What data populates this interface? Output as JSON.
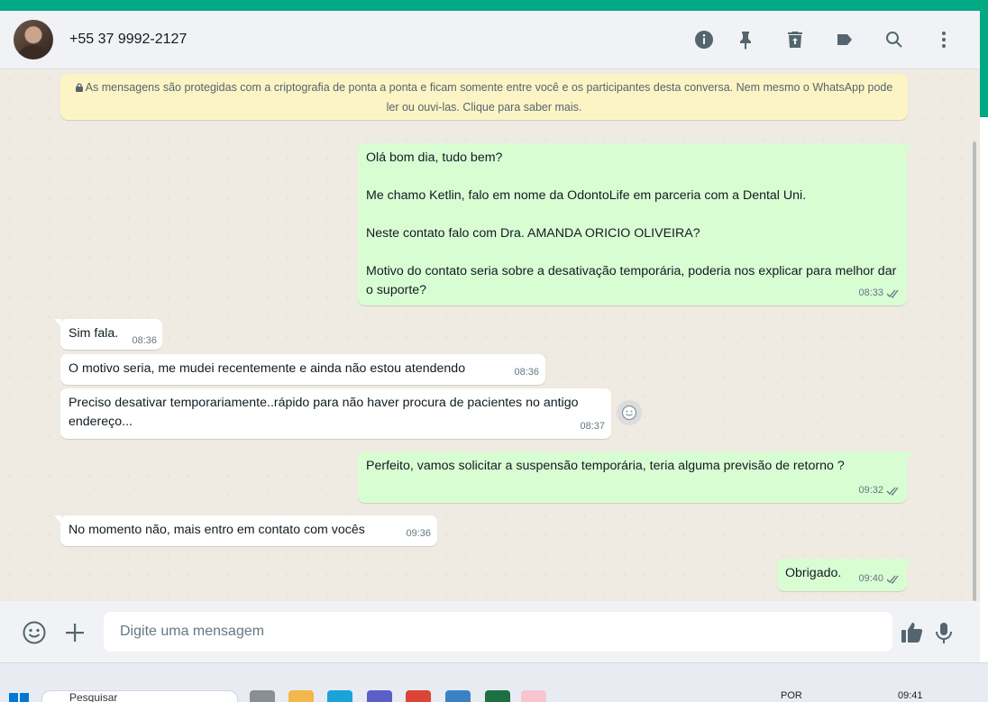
{
  "header": {
    "contact_name": "+55 37 9992-2127",
    "icons": [
      "info-icon",
      "pin-icon",
      "delete-icon",
      "label-icon",
      "search-icon",
      "menu-icon"
    ]
  },
  "encryption_notice": "As mensagens são protegidas com a criptografia de ponta a ponta e ficam somente entre você e os participantes desta conversa. Nem mesmo o WhatsApp pode ler ou ouvi-las. Clique para saber mais.",
  "messages": [
    {
      "dir": "out",
      "text": "Olá bom dia, tudo bem?\n\nMe chamo Ketlin, falo em nome da OdontoLife em parceria com a Dental Uni.\n\nNeste contato falo com Dra. AMANDA ORICIO OLIVEIRA?\n\nMotivo do contato seria sobre a desativação temporária, poderia nos explicar para melhor dar o suporte?",
      "time": "08:33",
      "status": "read"
    },
    {
      "dir": "in",
      "text": "Sim fala.",
      "time": "08:36"
    },
    {
      "dir": "in",
      "text": "O motivo seria, me mudei recentemente e ainda não estou atendendo",
      "time": "08:36"
    },
    {
      "dir": "in",
      "text": "Preciso desativar temporariamente..rápido para não haver procura de pacientes no antigo endereço...",
      "time": "08:37"
    },
    {
      "dir": "out",
      "text": "Perfeito, vamos solicitar a suspensão temporária, teria alguma previsão de retorno ?",
      "time": "09:32",
      "status": "read"
    },
    {
      "dir": "in",
      "text": "No momento não, mais entro em contato com vocês",
      "time": "09:36"
    },
    {
      "dir": "out",
      "text": "Obrigado.",
      "time": "09:40",
      "status": "read"
    }
  ],
  "composer": {
    "placeholder": "Digite uma mensagem"
  },
  "taskbar": {
    "search_label": "Pesquisar",
    "language": "POR",
    "clock": "09:41"
  },
  "colors": {
    "accent": "#00a884",
    "outgoing_bubble": "#d9fdd3",
    "incoming_bubble": "#ffffff",
    "chat_bg": "#efeae2",
    "read_ticks": "#667781"
  }
}
